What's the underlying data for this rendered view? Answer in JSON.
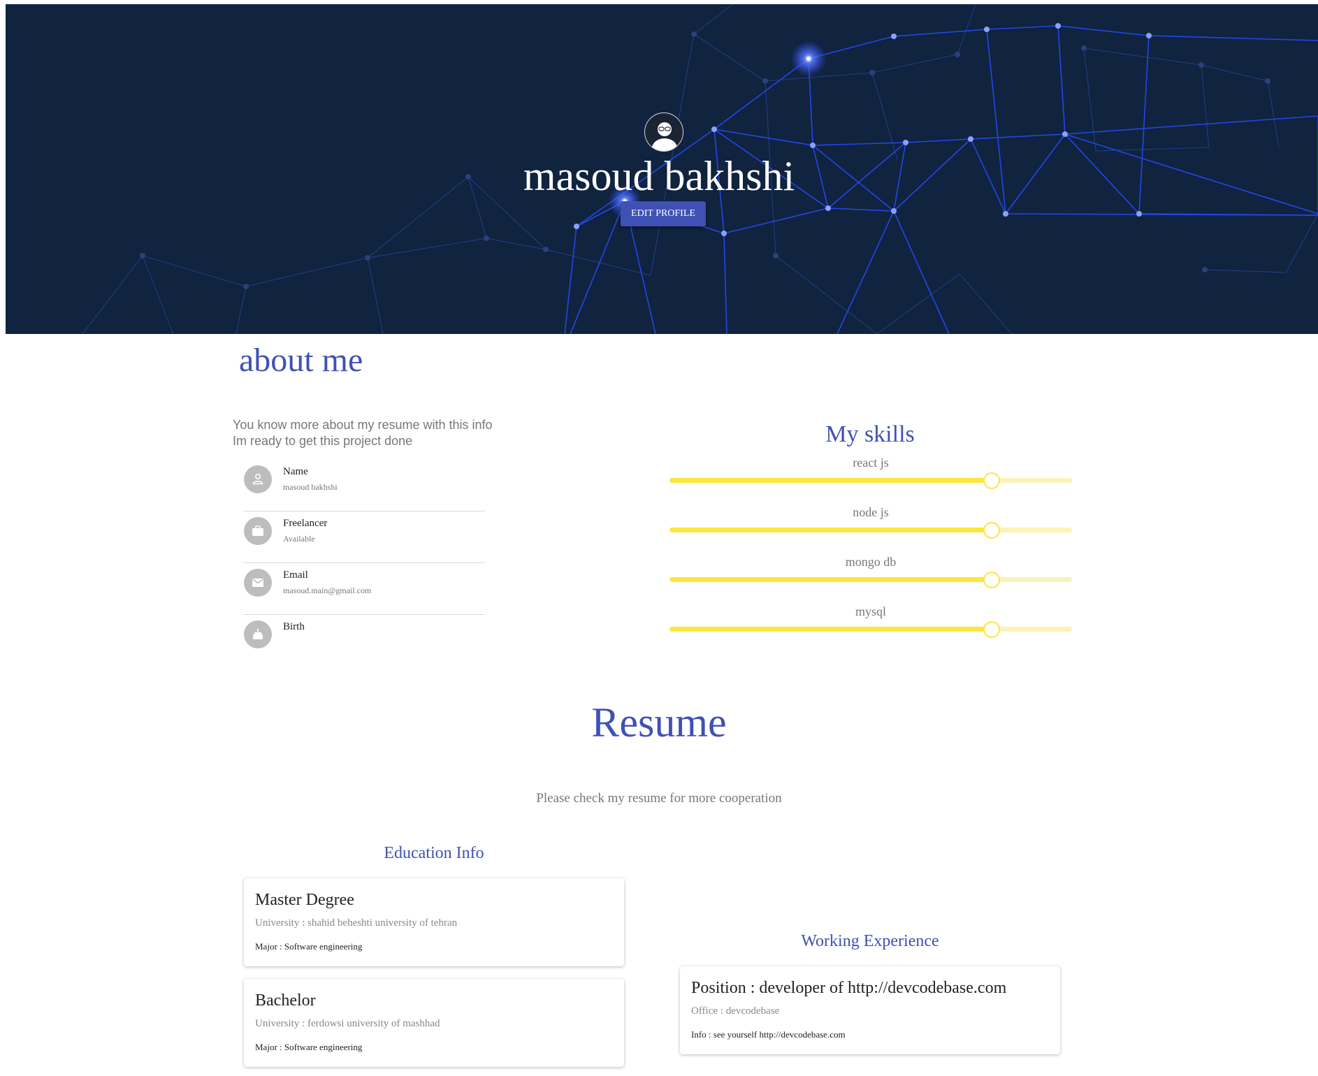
{
  "profile": {
    "name": "masoud bakhshi",
    "edit_label": "EDIT PROFILE"
  },
  "about": {
    "title": "about me",
    "intro_line1": "You know more about my resume with this info",
    "intro_line2": "Im ready to get this project done",
    "items": [
      {
        "label": "Name",
        "value": "masoud bakhshi",
        "icon": "person-icon"
      },
      {
        "label": "Freelancer",
        "value": "Available",
        "icon": "briefcase-icon"
      },
      {
        "label": "Email",
        "value": "masoud.main@gmail.com",
        "icon": "email-icon"
      },
      {
        "label": "Birth",
        "value": "",
        "icon": "cake-icon"
      }
    ]
  },
  "skills": {
    "title": "My skills",
    "items": [
      {
        "name": "react js",
        "level": 80
      },
      {
        "name": "node js",
        "level": 80
      },
      {
        "name": "mongo db",
        "level": 80
      },
      {
        "name": "mysql",
        "level": 80
      }
    ]
  },
  "resume": {
    "title": "Resume",
    "subtitle": "Please check my resume for more cooperation",
    "education_title": "Education Info",
    "education": [
      {
        "title": "Master Degree",
        "university": "University : shahid beheshti university of tehran",
        "major": "Major : Software engineering"
      },
      {
        "title": "Bachelor",
        "university": "University : ferdowsi university of mashhad",
        "major": "Major : Software engineering"
      }
    ],
    "experience_title": "Working Experience",
    "experience": [
      {
        "position": "Position : developer of http://devcodebase.com",
        "office": "Office : devcodebase",
        "info": "Info : see yourself http://devcodebase.com"
      }
    ]
  },
  "colors": {
    "hero_bg": "#10233f",
    "accent": "#3f51b5",
    "slider": "#fde63f"
  }
}
